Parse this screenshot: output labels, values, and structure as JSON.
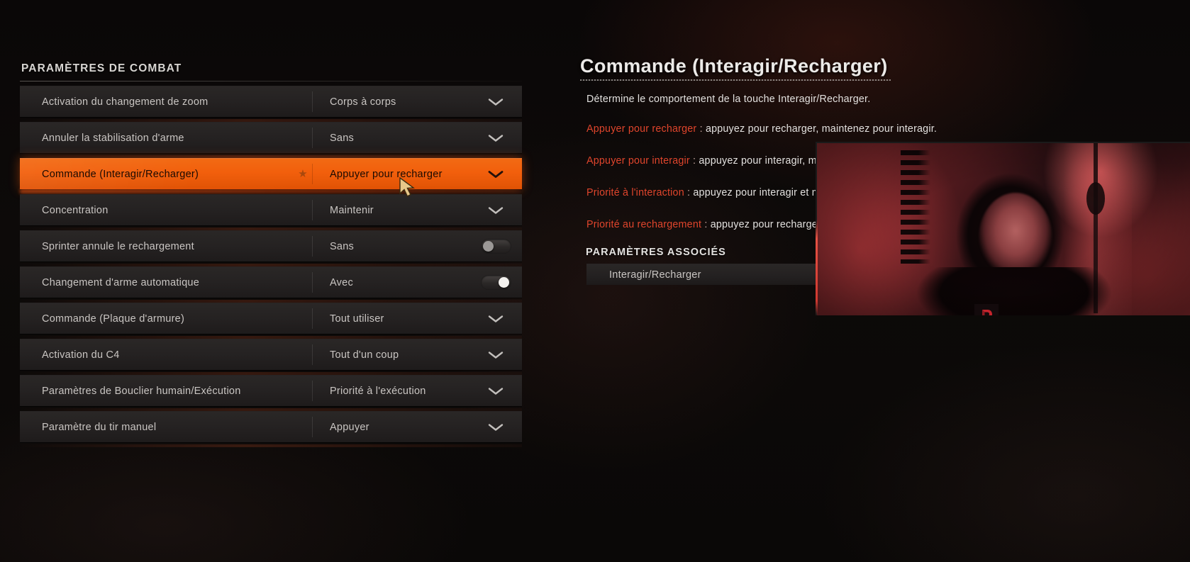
{
  "section": {
    "title": "PARAMÈTRES DE COMBAT"
  },
  "settings": [
    {
      "label": "Activation du changement de zoom",
      "value": "Corps à corps",
      "control": "chevron",
      "starred": false,
      "highlighted": false
    },
    {
      "label": "Annuler la stabilisation d'arme",
      "value": "Sans",
      "control": "chevron",
      "starred": false,
      "highlighted": false
    },
    {
      "label": "Commande (Interagir/Recharger)",
      "value": "Appuyer pour recharger",
      "control": "chevron",
      "starred": true,
      "highlighted": true
    },
    {
      "label": "Concentration",
      "value": "Maintenir",
      "control": "chevron",
      "starred": false,
      "highlighted": false
    },
    {
      "label": "Sprinter annule le rechargement",
      "value": "Sans",
      "control": "toggle-off",
      "starred": false,
      "highlighted": false
    },
    {
      "label": "Changement d'arme automatique",
      "value": "Avec",
      "control": "toggle-on",
      "starred": false,
      "highlighted": false
    },
    {
      "label": "Commande (Plaque d'armure)",
      "value": "Tout utiliser",
      "control": "chevron",
      "starred": false,
      "highlighted": false
    },
    {
      "label": "Activation du C4",
      "value": "Tout d'un coup",
      "control": "chevron",
      "starred": false,
      "highlighted": false
    },
    {
      "label": "Paramètres de Bouclier humain/Exécution",
      "value": "Priorité à l'exécution",
      "control": "chevron",
      "starred": false,
      "highlighted": false
    },
    {
      "label": "Paramètre du tir manuel",
      "value": "Appuyer",
      "control": "chevron",
      "starred": false,
      "highlighted": false
    }
  ],
  "detail": {
    "title": "Commande (Interagir/Recharger)",
    "summary": "Détermine le comportement de la touche Interagir/Recharger.",
    "options": [
      {
        "key": "Appuyer pour recharger",
        "sep": " : ",
        "text": "appuyez pour recharger, maintenez pour interagir."
      },
      {
        "key": "Appuyer pour interagir",
        "sep": " : ",
        "text": "appuyez pour interagir, maintenez pour recharger."
      },
      {
        "key": "Priorité à l'interaction",
        "sep": " : ",
        "text": "appuyez pour interagir et maintenez pour recharger en même temps."
      },
      {
        "key": "Priorité au rechargement",
        "sep": " : ",
        "text": "appuyez pour recharger et maintenez pour interagir en même temps."
      }
    ],
    "associated_heading": "PARAMÈTRES ASSOCIÉS",
    "associated_items": [
      {
        "label": "Interagir/Recharger"
      }
    ]
  },
  "overlay": {
    "webcam_logo": "p-logo"
  },
  "colors": {
    "highlight_orange": "#f25f0c",
    "option_key_red": "#e0452c",
    "row_background": "#252222",
    "text_primary": "#c9c5c2",
    "page_background": "#0a0807"
  },
  "icons": {
    "star": "★",
    "chevron_down": "chevron-down-icon",
    "cursor": "mouse-cursor"
  }
}
